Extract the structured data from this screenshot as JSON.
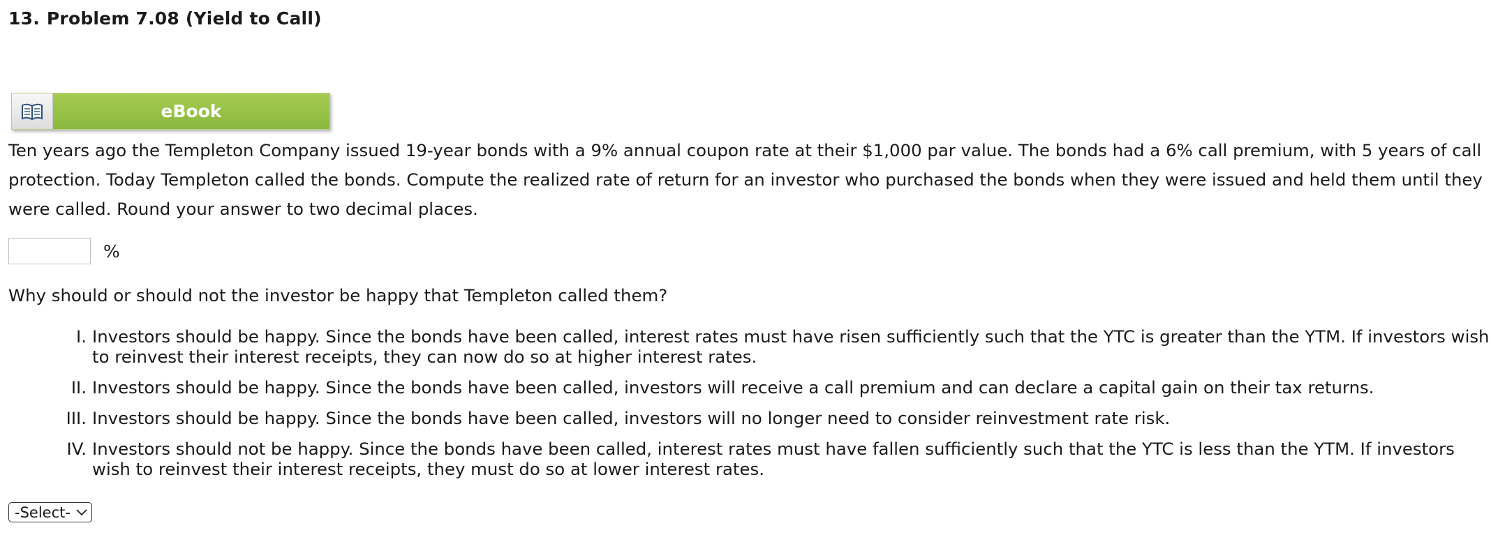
{
  "problem": {
    "number": "13.",
    "title": "Problem 7.08 (Yield to Call)"
  },
  "ebook": {
    "label": "eBook",
    "icon": "book-icon"
  },
  "prompt_lines": [
    "Ten years ago the Templeton Company issued 19-year bonds with a 9% annual coupon rate at their $1,000 par value. The bonds had a 6% call premium, with 5 years of call",
    "protection. Today Templeton called the bonds. Compute the realized rate of return for an investor who purchased the bonds when they were issued and held them until they",
    "were called. Round your answer to two decimal places."
  ],
  "answer": {
    "value": "",
    "placeholder": "",
    "unit": "%"
  },
  "question": "Why should or should not the investor be happy that Templeton called them?",
  "options": [
    {
      "marker": "I.",
      "lines": [
        "Investors should be happy. Since the bonds have been called, interest rates must have risen sufficiently such that the YTC is greater than the YTM. If investors wish",
        "to reinvest their interest receipts, they can now do so at higher interest rates."
      ]
    },
    {
      "marker": "II.",
      "lines": [
        "Investors should be happy. Since the bonds have been called, investors will receive a call premium and can declare a capital gain on their tax returns."
      ]
    },
    {
      "marker": "III.",
      "lines": [
        "Investors should be happy. Since the bonds have been called, investors will no longer need to consider reinvestment rate risk."
      ]
    },
    {
      "marker": "IV.",
      "lines": [
        "Investors should not be happy. Since the bonds have been called, interest rates must have fallen sufficiently such that the YTC is less than the YTM. If investors",
        "wish to reinvest their interest receipts, they must do so at lower interest rates."
      ]
    }
  ],
  "select": {
    "selected": "-Select-",
    "icon": "chevron-down-icon"
  },
  "colors": {
    "ebook_green": "#93c047",
    "text": "#1a1a1a"
  }
}
